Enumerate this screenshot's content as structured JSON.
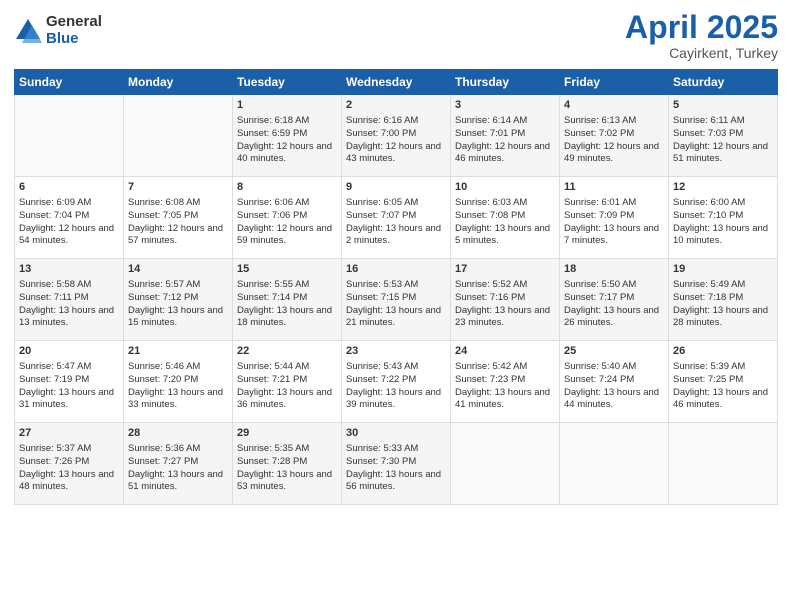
{
  "header": {
    "logo_general": "General",
    "logo_blue": "Blue",
    "month_title": "April 2025",
    "subtitle": "Cayirkent, Turkey"
  },
  "weekdays": [
    "Sunday",
    "Monday",
    "Tuesday",
    "Wednesday",
    "Thursday",
    "Friday",
    "Saturday"
  ],
  "weeks": [
    [
      {
        "day": "",
        "info": ""
      },
      {
        "day": "",
        "info": ""
      },
      {
        "day": "1",
        "info": "Sunrise: 6:18 AM\nSunset: 6:59 PM\nDaylight: 12 hours and 40 minutes."
      },
      {
        "day": "2",
        "info": "Sunrise: 6:16 AM\nSunset: 7:00 PM\nDaylight: 12 hours and 43 minutes."
      },
      {
        "day": "3",
        "info": "Sunrise: 6:14 AM\nSunset: 7:01 PM\nDaylight: 12 hours and 46 minutes."
      },
      {
        "day": "4",
        "info": "Sunrise: 6:13 AM\nSunset: 7:02 PM\nDaylight: 12 hours and 49 minutes."
      },
      {
        "day": "5",
        "info": "Sunrise: 6:11 AM\nSunset: 7:03 PM\nDaylight: 12 hours and 51 minutes."
      }
    ],
    [
      {
        "day": "6",
        "info": "Sunrise: 6:09 AM\nSunset: 7:04 PM\nDaylight: 12 hours and 54 minutes."
      },
      {
        "day": "7",
        "info": "Sunrise: 6:08 AM\nSunset: 7:05 PM\nDaylight: 12 hours and 57 minutes."
      },
      {
        "day": "8",
        "info": "Sunrise: 6:06 AM\nSunset: 7:06 PM\nDaylight: 12 hours and 59 minutes."
      },
      {
        "day": "9",
        "info": "Sunrise: 6:05 AM\nSunset: 7:07 PM\nDaylight: 13 hours and 2 minutes."
      },
      {
        "day": "10",
        "info": "Sunrise: 6:03 AM\nSunset: 7:08 PM\nDaylight: 13 hours and 5 minutes."
      },
      {
        "day": "11",
        "info": "Sunrise: 6:01 AM\nSunset: 7:09 PM\nDaylight: 13 hours and 7 minutes."
      },
      {
        "day": "12",
        "info": "Sunrise: 6:00 AM\nSunset: 7:10 PM\nDaylight: 13 hours and 10 minutes."
      }
    ],
    [
      {
        "day": "13",
        "info": "Sunrise: 5:58 AM\nSunset: 7:11 PM\nDaylight: 13 hours and 13 minutes."
      },
      {
        "day": "14",
        "info": "Sunrise: 5:57 AM\nSunset: 7:12 PM\nDaylight: 13 hours and 15 minutes."
      },
      {
        "day": "15",
        "info": "Sunrise: 5:55 AM\nSunset: 7:14 PM\nDaylight: 13 hours and 18 minutes."
      },
      {
        "day": "16",
        "info": "Sunrise: 5:53 AM\nSunset: 7:15 PM\nDaylight: 13 hours and 21 minutes."
      },
      {
        "day": "17",
        "info": "Sunrise: 5:52 AM\nSunset: 7:16 PM\nDaylight: 13 hours and 23 minutes."
      },
      {
        "day": "18",
        "info": "Sunrise: 5:50 AM\nSunset: 7:17 PM\nDaylight: 13 hours and 26 minutes."
      },
      {
        "day": "19",
        "info": "Sunrise: 5:49 AM\nSunset: 7:18 PM\nDaylight: 13 hours and 28 minutes."
      }
    ],
    [
      {
        "day": "20",
        "info": "Sunrise: 5:47 AM\nSunset: 7:19 PM\nDaylight: 13 hours and 31 minutes."
      },
      {
        "day": "21",
        "info": "Sunrise: 5:46 AM\nSunset: 7:20 PM\nDaylight: 13 hours and 33 minutes."
      },
      {
        "day": "22",
        "info": "Sunrise: 5:44 AM\nSunset: 7:21 PM\nDaylight: 13 hours and 36 minutes."
      },
      {
        "day": "23",
        "info": "Sunrise: 5:43 AM\nSunset: 7:22 PM\nDaylight: 13 hours and 39 minutes."
      },
      {
        "day": "24",
        "info": "Sunrise: 5:42 AM\nSunset: 7:23 PM\nDaylight: 13 hours and 41 minutes."
      },
      {
        "day": "25",
        "info": "Sunrise: 5:40 AM\nSunset: 7:24 PM\nDaylight: 13 hours and 44 minutes."
      },
      {
        "day": "26",
        "info": "Sunrise: 5:39 AM\nSunset: 7:25 PM\nDaylight: 13 hours and 46 minutes."
      }
    ],
    [
      {
        "day": "27",
        "info": "Sunrise: 5:37 AM\nSunset: 7:26 PM\nDaylight: 13 hours and 48 minutes."
      },
      {
        "day": "28",
        "info": "Sunrise: 5:36 AM\nSunset: 7:27 PM\nDaylight: 13 hours and 51 minutes."
      },
      {
        "day": "29",
        "info": "Sunrise: 5:35 AM\nSunset: 7:28 PM\nDaylight: 13 hours and 53 minutes."
      },
      {
        "day": "30",
        "info": "Sunrise: 5:33 AM\nSunset: 7:30 PM\nDaylight: 13 hours and 56 minutes."
      },
      {
        "day": "",
        "info": ""
      },
      {
        "day": "",
        "info": ""
      },
      {
        "day": "",
        "info": ""
      }
    ]
  ]
}
